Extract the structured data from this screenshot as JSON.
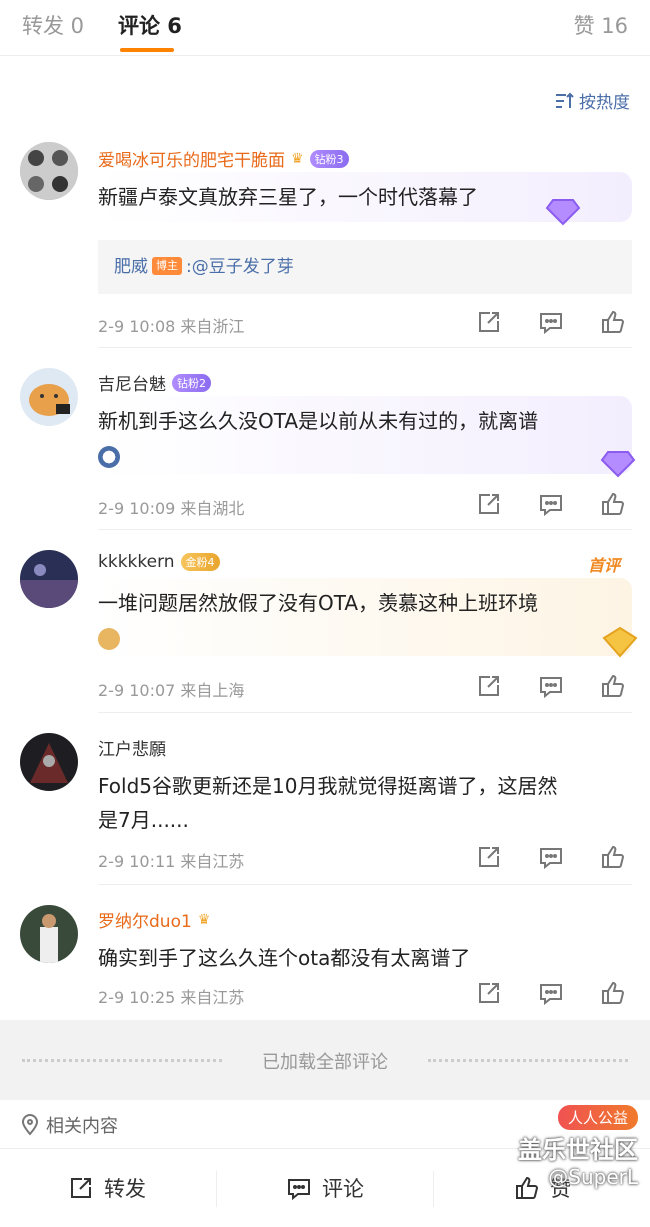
{
  "tabs": {
    "repost": "转发 0",
    "comment": "评论 6",
    "like": "赞 16"
  },
  "sort_label": "按热度",
  "comments": [
    {
      "username": "爱喝冰可乐的肥宅干脆面",
      "badge": "钻粉3",
      "text": "新疆卢泰文真放弃三星了，一个时代落幕了",
      "meta": "2-9 10:08  来自浙江",
      "reply": {
        "name": "肥威",
        "tag": "博主",
        "text": ":@豆子发了芽"
      }
    },
    {
      "username": "吉尼台魅",
      "badge": "钻粉2",
      "text": "新机到手这么久没OTA是以前从未有过的，就离谱",
      "meta": "2-9 10:09  来自湖北"
    },
    {
      "username": "kkkkkern",
      "badge": "金粉4",
      "text": "一堆问题居然放假了没有OTA，羡慕这种上班环境",
      "meta": "2-9 10:07  来自上海",
      "first_tag": "首评"
    },
    {
      "username": "江户悲願",
      "text_line1": "Fold5谷歌更新还是10月我就觉得挺离谱了，这居然",
      "text_line2": "是7月......",
      "meta": "2-9 10:11  来自江苏"
    },
    {
      "username": "罗纳尔duo1",
      "text": "确实到手了这么久连个ota都没有太离谱了",
      "meta": "2-9 10:25  来自江苏"
    }
  ],
  "loaded_label": "已加载全部评论",
  "related_label": "相关内容",
  "bottom": {
    "repost": "转发",
    "comment": "评论",
    "like": "赞"
  },
  "watermark": {
    "pill": "人人公益",
    "title": "盖乐世社区",
    "user": "@SuperL"
  },
  "colors": {
    "accent": "#ff8200",
    "link": "#4a6ea8",
    "username_vip": "#e86a1a"
  }
}
